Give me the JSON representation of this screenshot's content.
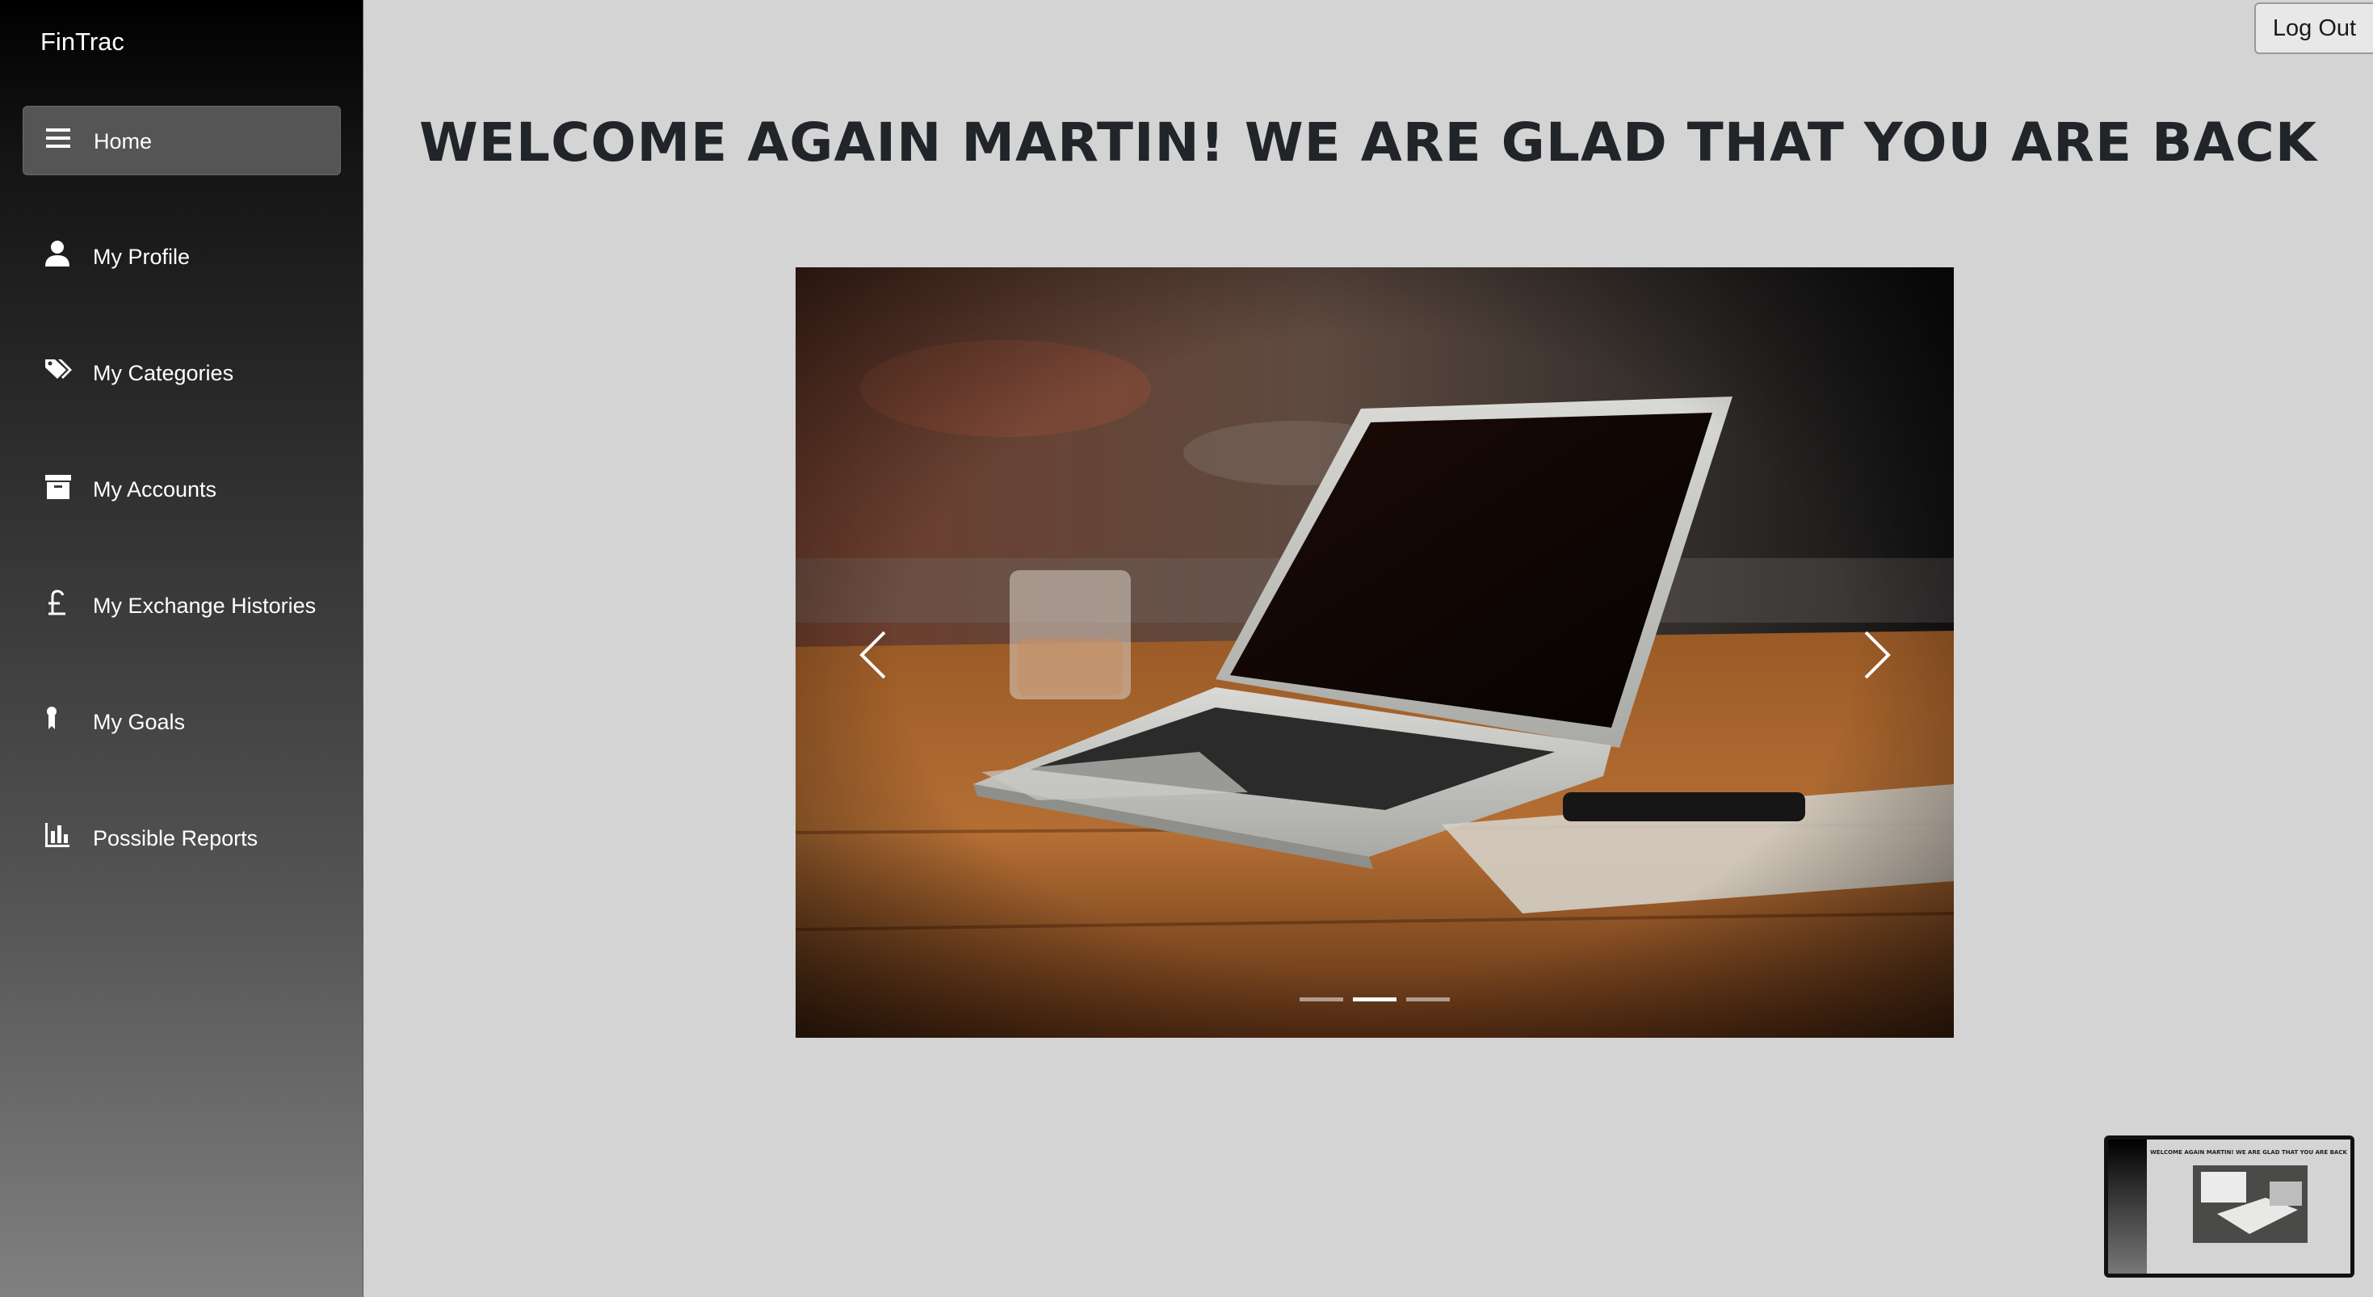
{
  "brand": "FinTrac",
  "nav": [
    {
      "label": "Home",
      "icon": "menu-icon",
      "active": true
    },
    {
      "label": "My Profile",
      "icon": "user-icon"
    },
    {
      "label": "My Categories",
      "icon": "tags-icon"
    },
    {
      "label": "My Accounts",
      "icon": "archive-icon"
    },
    {
      "label": "My Exchange Histories",
      "icon": "pound-icon"
    },
    {
      "label": "My Goals",
      "icon": "award-icon"
    },
    {
      "label": "Possible Reports",
      "icon": "bar-chart-icon"
    }
  ],
  "header": {
    "logout_label": "Log Out"
  },
  "main": {
    "welcome": "WELCOME AGAIN MARTIN! WE ARE GLAD THAT YOU ARE BACK"
  },
  "carousel": {
    "slide_count": 3,
    "active_slide": 2,
    "image": "laptop-on-wooden-table"
  },
  "thumbnail": {
    "title": "WELCOME AGAIN MARTIN! WE ARE GLAD THAT YOU ARE BACK"
  },
  "colors": {
    "page_bg": "#d4d4d4",
    "sidebar_top": "#000000",
    "sidebar_bottom": "#808080",
    "active_nav": "#555555"
  }
}
